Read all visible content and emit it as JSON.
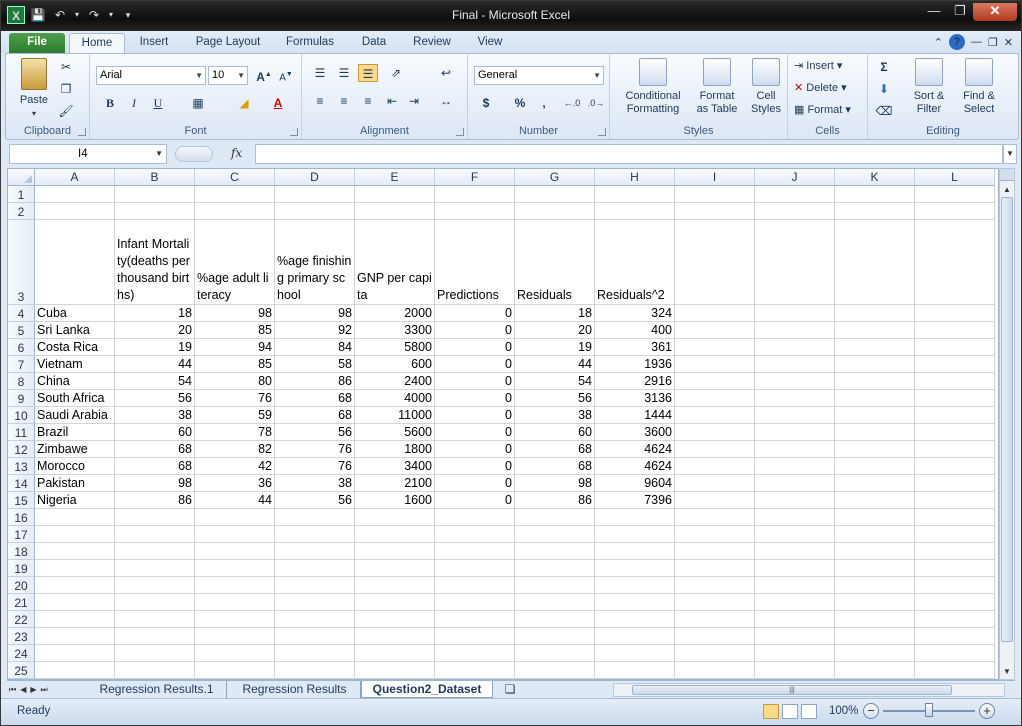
{
  "app": {
    "window_title": "Final  -  Microsoft Excel",
    "file_tab": "File",
    "tabs": [
      "Home",
      "Insert",
      "Page Layout",
      "Formulas",
      "Data",
      "Review",
      "View"
    ]
  },
  "ribbon": {
    "clipboard": {
      "paste": "Paste",
      "label": "Clipboard"
    },
    "font": {
      "name": "Arial",
      "size": "10",
      "label": "Font",
      "bold": "B",
      "italic": "I",
      "underline": "U"
    },
    "alignment": {
      "label": "Alignment"
    },
    "number": {
      "format": "General",
      "label": "Number",
      "currency": "$",
      "percent": "%",
      "comma": ","
    },
    "styles": {
      "conditional": "Conditional",
      "conditional2": "Formatting",
      "format_table": "Format",
      "format_table2": "as Table",
      "cell_styles": "Cell",
      "cell_styles2": "Styles",
      "label": "Styles"
    },
    "cells": {
      "insert": "Insert",
      "delete": "Delete",
      "format": "Format",
      "label": "Cells"
    },
    "editing": {
      "sigma": "Σ",
      "sort": "Sort &",
      "sort2": "Filter",
      "find": "Find &",
      "find2": "Select",
      "label": "Editing"
    }
  },
  "formula_bar": {
    "name_box": "I4",
    "fx": "fx",
    "formula": ""
  },
  "grid": {
    "columns": [
      "A",
      "B",
      "C",
      "D",
      "E",
      "F",
      "G",
      "H",
      "I",
      "J",
      "K",
      "L"
    ],
    "row_numbers": [
      "1",
      "2",
      "3",
      "4",
      "5",
      "6",
      "7",
      "8",
      "9",
      "10",
      "11",
      "12",
      "13",
      "14",
      "15",
      "16",
      "17",
      "18",
      "19",
      "20",
      "21",
      "22",
      "23",
      "24",
      "25"
    ],
    "headers": {
      "B": "Infant Mortality(deaths per thousand births)",
      "C": "%age adult literacy",
      "D": "%age finishing primary school",
      "E": "GNP per capita",
      "F": "Predictions",
      "G": "Residuals",
      "H": "Residuals^2"
    },
    "rows": [
      [
        "Cuba",
        "18",
        "98",
        "98",
        "2000",
        "0",
        "18",
        "324"
      ],
      [
        "Sri Lanka",
        "20",
        "85",
        "92",
        "3300",
        "0",
        "20",
        "400"
      ],
      [
        "Costa Rica",
        "19",
        "94",
        "84",
        "5800",
        "0",
        "19",
        "361"
      ],
      [
        "Vietnam",
        "44",
        "85",
        "58",
        "600",
        "0",
        "44",
        "1936"
      ],
      [
        "China",
        "54",
        "80",
        "86",
        "2400",
        "0",
        "54",
        "2916"
      ],
      [
        "South Africa",
        "56",
        "76",
        "68",
        "4000",
        "0",
        "56",
        "3136"
      ],
      [
        "Saudi Arabia",
        "38",
        "59",
        "68",
        "11000",
        "0",
        "38",
        "1444"
      ],
      [
        "Brazil",
        "60",
        "78",
        "56",
        "5600",
        "0",
        "60",
        "3600"
      ],
      [
        "Zimbawe",
        "68",
        "82",
        "76",
        "1800",
        "0",
        "68",
        "4624"
      ],
      [
        "Morocco",
        "68",
        "42",
        "76",
        "3400",
        "0",
        "68",
        "4624"
      ],
      [
        "Pakistan",
        "98",
        "36",
        "38",
        "2100",
        "0",
        "98",
        "9604"
      ],
      [
        "Nigeria",
        "86",
        "44",
        "56",
        "1600",
        "0",
        "86",
        "7396"
      ]
    ]
  },
  "sheets": {
    "tab1": "Regression Results.1",
    "tab2": "Regression Results",
    "tab3": "Question2_Dataset"
  },
  "status": {
    "ready": "Ready",
    "zoom": "100%"
  },
  "colors": {
    "file_tab": "#2c7a2c",
    "ribbon_bg": "#dfe9f5",
    "title_bg": "#0d0d0d"
  }
}
